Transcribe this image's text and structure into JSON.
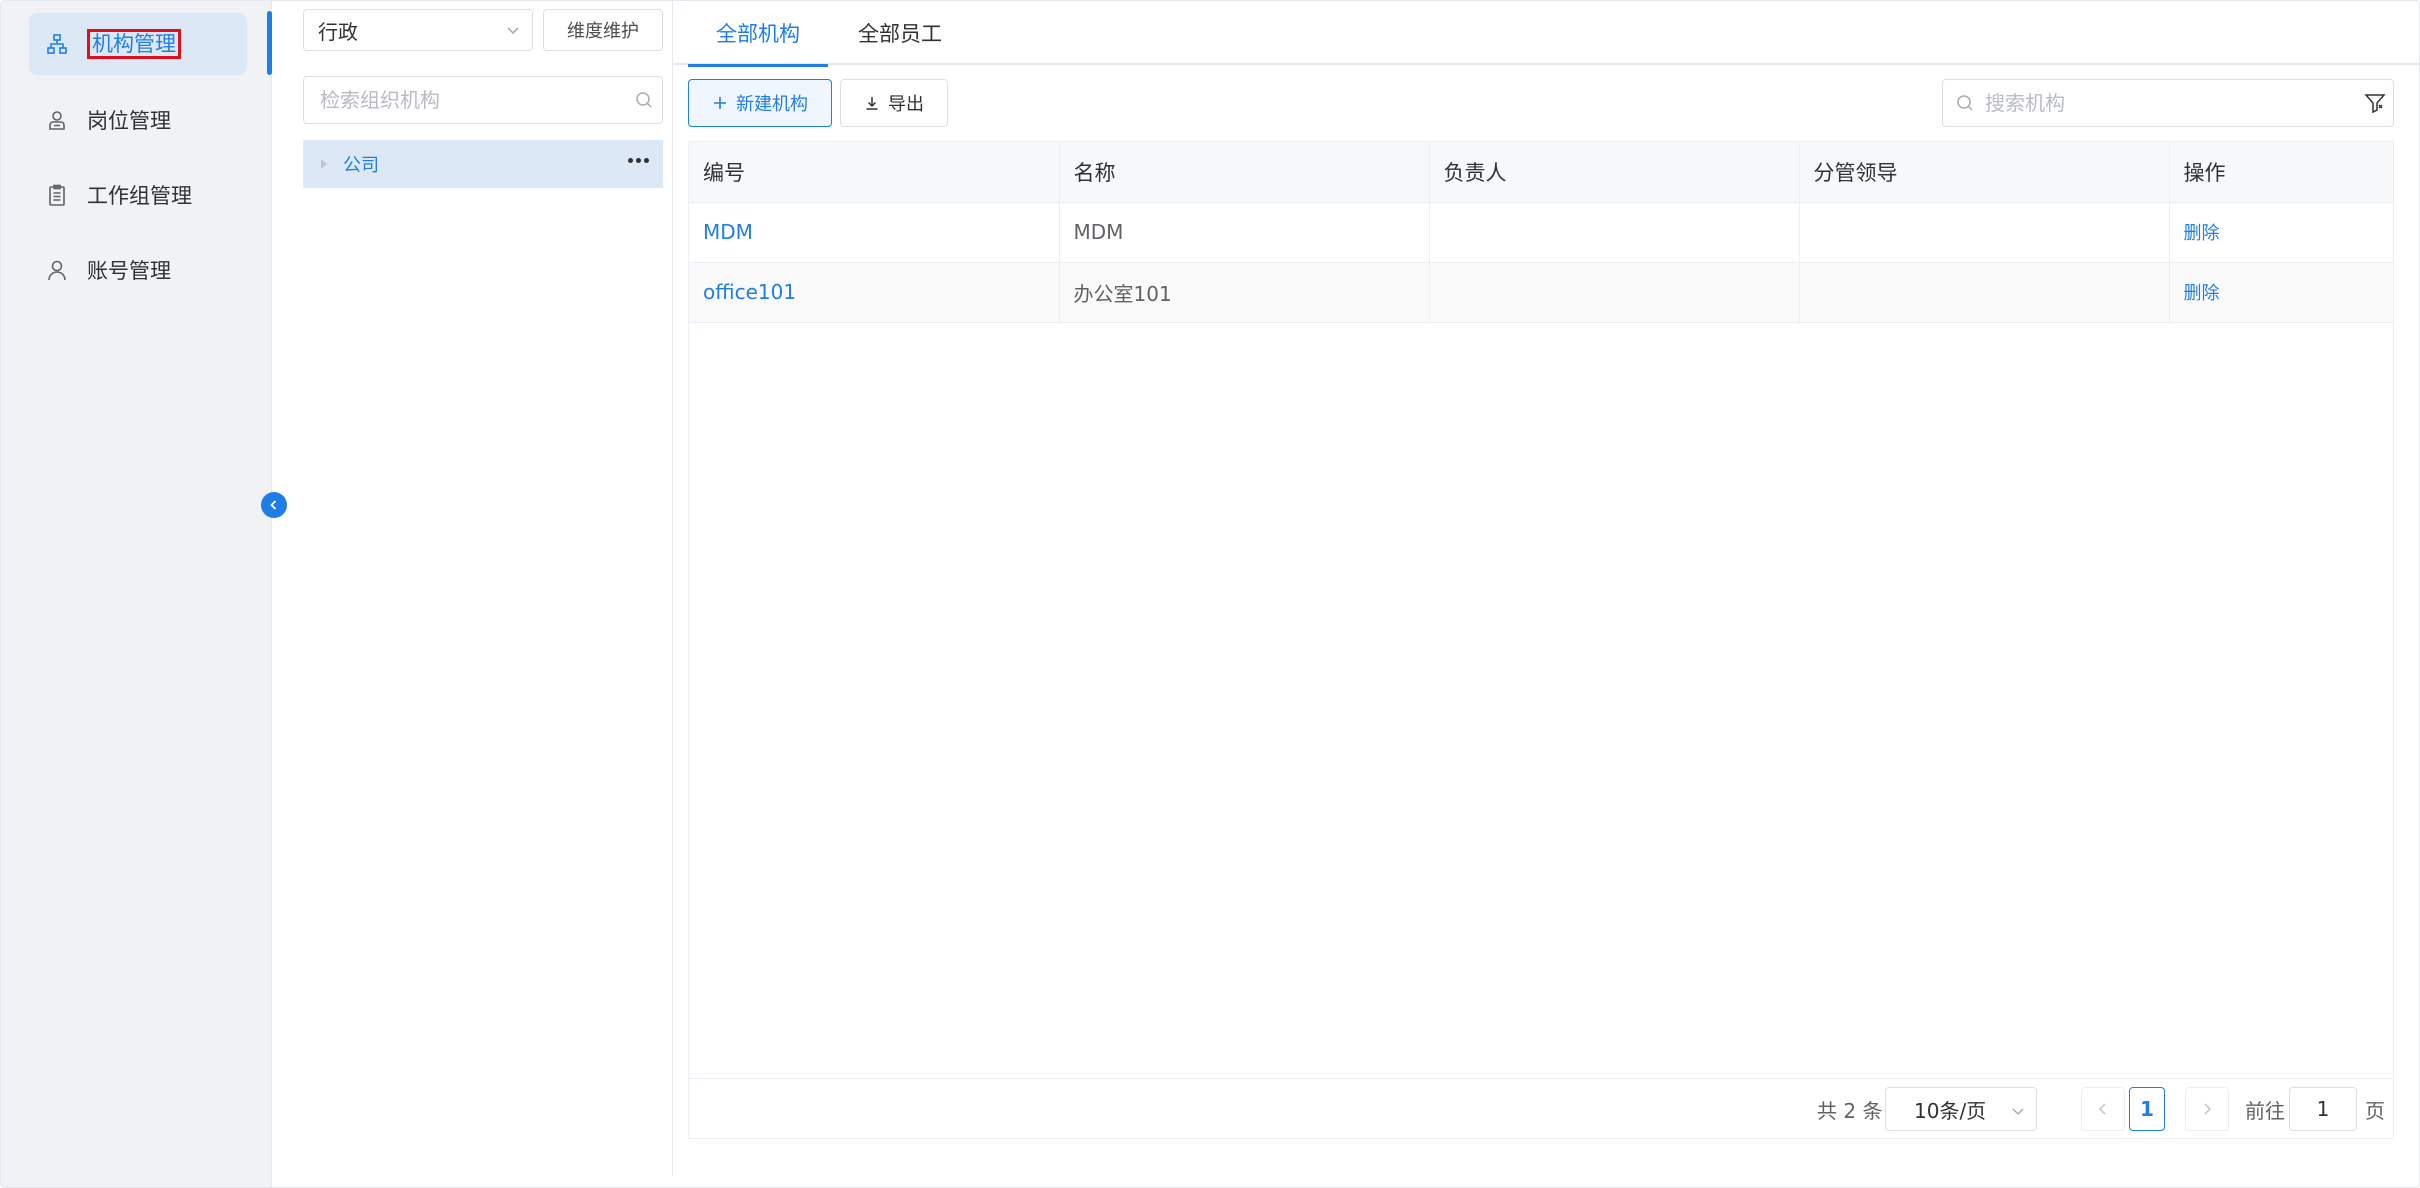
{
  "sidebar": {
    "items": [
      {
        "label": "机构管理",
        "icon": "org-chart-icon",
        "active": true
      },
      {
        "label": "岗位管理",
        "icon": "position-user-icon",
        "active": false
      },
      {
        "label": "工作组管理",
        "icon": "clipboard-icon",
        "active": false
      },
      {
        "label": "账号管理",
        "icon": "user-icon",
        "active": false
      }
    ]
  },
  "tree_panel": {
    "dimension_select": "行政",
    "dimension_button": "维度维护",
    "search_placeholder": "检索组织机构",
    "nodes": [
      {
        "label": "公司",
        "selected": true
      }
    ]
  },
  "tabs": [
    {
      "label": "全部机构",
      "active": true
    },
    {
      "label": "全部员工",
      "active": false
    }
  ],
  "toolbar": {
    "new_label": "新建机构",
    "export_label": "导出",
    "search_placeholder": "搜索机构"
  },
  "table": {
    "columns": [
      "编号",
      "名称",
      "负责人",
      "分管领导",
      "操作"
    ],
    "rows": [
      {
        "code": "MDM",
        "name": "MDM",
        "owner": "",
        "leader": "",
        "action": "删除"
      },
      {
        "code": "office101",
        "name": "办公室101",
        "owner": "",
        "leader": "",
        "action": "删除"
      }
    ]
  },
  "pagination": {
    "total_text": "共 2 条",
    "page_size": "10条/页",
    "current_page": "1",
    "goto_label": "前往",
    "goto_value": "1",
    "page_suffix": "页"
  },
  "colors": {
    "accent": "#1f7ee6",
    "sidebar_bg": "#f0f2f5",
    "active_bg": "#dde8f6",
    "highlight_border": "#e0101a"
  }
}
